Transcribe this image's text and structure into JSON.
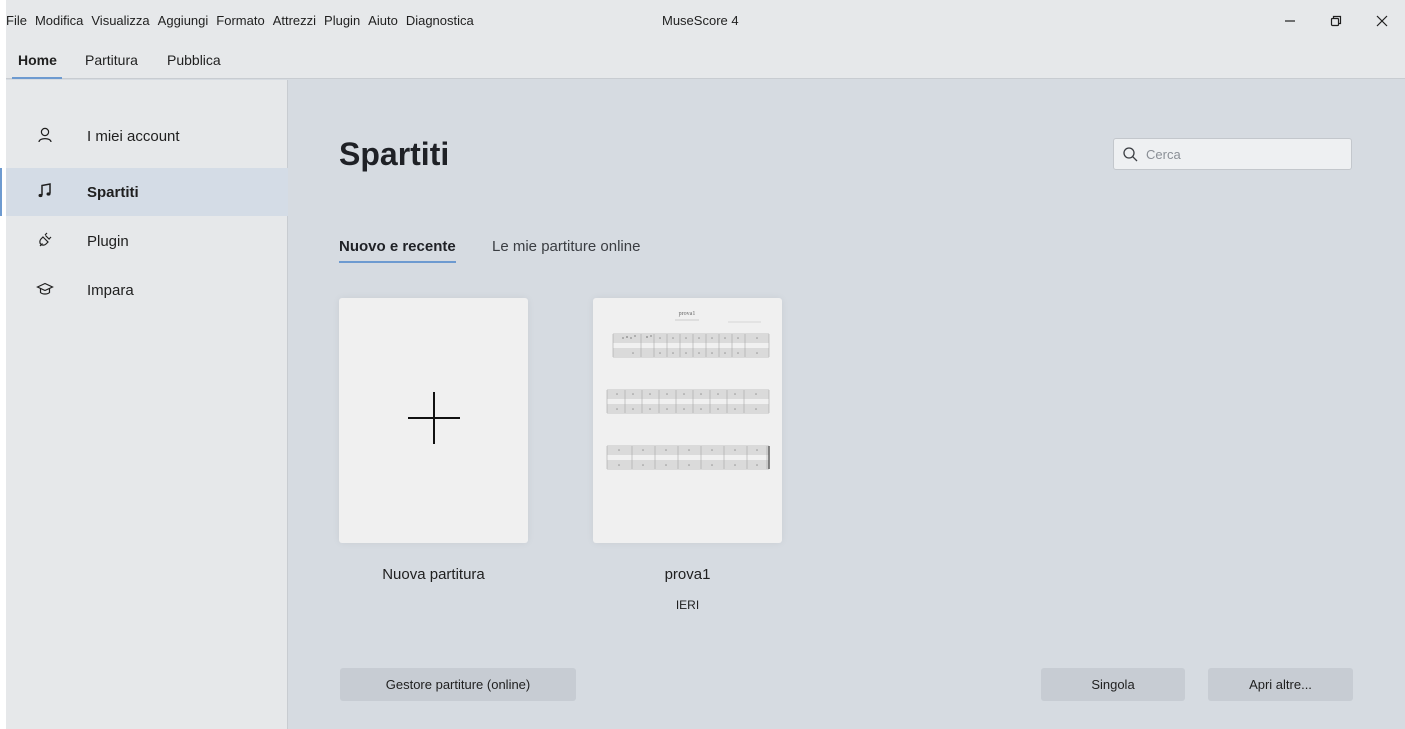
{
  "menu": [
    "File",
    "Modifica",
    "Visualizza",
    "Aggiungi",
    "Formato",
    "Attrezzi",
    "Plugin",
    "Aiuto",
    "Diagnostica"
  ],
  "app_title": "MuseScore 4",
  "main_tabs": [
    {
      "label": "Home",
      "active": true
    },
    {
      "label": "Partitura",
      "active": false
    },
    {
      "label": "Pubblica",
      "active": false
    }
  ],
  "sidebar": {
    "items": [
      {
        "label": "I miei account",
        "icon": "account-icon",
        "active": false
      },
      {
        "label": "Spartiti",
        "icon": "music-note-icon",
        "active": true
      },
      {
        "label": "Plugin",
        "icon": "plugin-icon",
        "active": false
      },
      {
        "label": "Impara",
        "icon": "learn-icon",
        "active": false
      }
    ]
  },
  "main": {
    "title": "Spartiti",
    "search_placeholder": "Cerca",
    "tabs": [
      {
        "label": "Nuovo e recente",
        "active": true
      },
      {
        "label": "Le mie partiture online",
        "active": false
      }
    ],
    "cards": [
      {
        "label": "Nuova partitura",
        "sub": ""
      },
      {
        "label": "prova1",
        "sub": "IERI",
        "thumb_title": "prova1"
      }
    ],
    "buttons": {
      "score_manager": "Gestore partiture (online)",
      "single": "Singola",
      "open_other": "Apri altre..."
    }
  },
  "colors": {
    "accent": "#6d9ad0",
    "background": "#d6dbe1",
    "panel": "#e6e8ea",
    "button": "#c7ccd3"
  }
}
